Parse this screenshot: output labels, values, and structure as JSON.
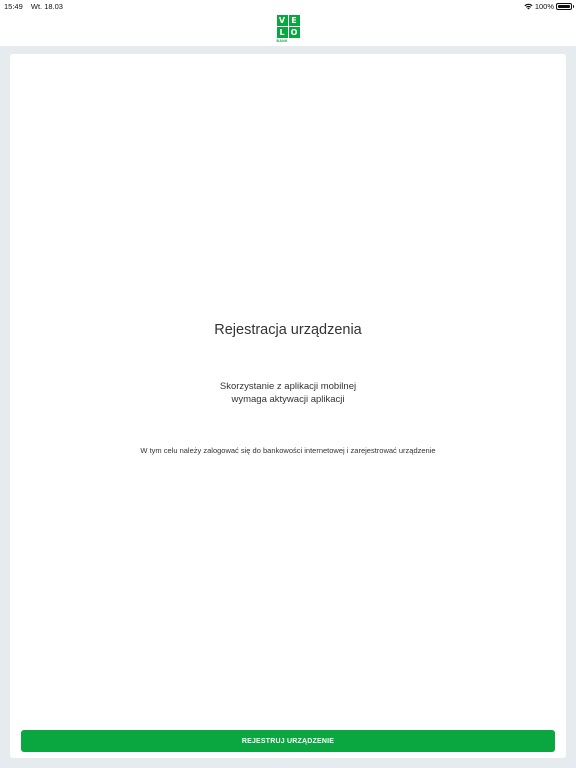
{
  "status_bar": {
    "time": "15:49",
    "date": "Wt. 18.03",
    "battery": "100%",
    "icons": [
      "wifi-icon",
      "battery-icon"
    ]
  },
  "header": {
    "logo_letters": [
      "V",
      "E",
      "L",
      "O"
    ],
    "logo_sub": "BANK",
    "brand_color": "#0aa640"
  },
  "main": {
    "title": "Rejestracja urządzenia",
    "subtitle_line1": "Skorzystanie z aplikacji mobilnej",
    "subtitle_line2": "wymaga aktywacji aplikacji",
    "info": "W tym celu należy zalogować się do bankowości internetowej i zarejestrować urządzenie",
    "register_button": "REJESTRUJ URZĄDZENIE"
  },
  "colors": {
    "background": "#e6ebf0",
    "card": "#ffffff",
    "accent": "#0aa640"
  }
}
